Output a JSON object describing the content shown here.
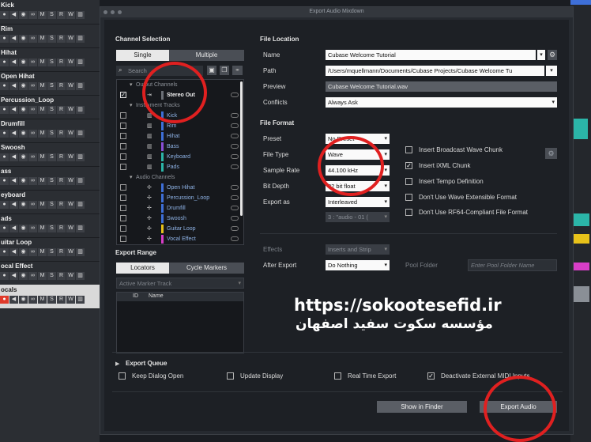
{
  "tracks": [
    {
      "name": "Kick"
    },
    {
      "name": "Rim"
    },
    {
      "name": "Hihat"
    },
    {
      "name": "Open Hihat"
    },
    {
      "name": "Percussion_Loop"
    },
    {
      "name": "Drumfill"
    },
    {
      "name": "Swoosh"
    },
    {
      "name": "ass"
    },
    {
      "name": "eyboard"
    },
    {
      "name": "ads"
    },
    {
      "name": "uitar Loop"
    },
    {
      "name": "ocal Effect"
    },
    {
      "name": "ocals"
    }
  ],
  "track_buttons": {
    "mute": "M",
    "solo": "S",
    "read": "R",
    "write": "W"
  },
  "dialog": {
    "title": "Export Audio Mixdown",
    "channel_selection": {
      "heading": "Channel Selection",
      "tab_single": "Single",
      "tab_multiple": "Multiple",
      "search_placeholder": "Search",
      "groups": {
        "output": "Output Channels",
        "instrument": "Instrument Tracks",
        "audio": "Audio Channels"
      },
      "stereo_out": "Stereo Out",
      "instrument_tracks": [
        {
          "name": "Kick",
          "color": "#3e6fd8"
        },
        {
          "name": "Rim",
          "color": "#3e6fd8"
        },
        {
          "name": "Hihat",
          "color": "#3e6fd8"
        },
        {
          "name": "Bass",
          "color": "#8a4fd8"
        },
        {
          "name": "Keyboard",
          "color": "#2bb5a8"
        },
        {
          "name": "Pads",
          "color": "#2bb5a8"
        }
      ],
      "audio_channels": [
        {
          "name": "Open Hihat",
          "color": "#3e6fd8"
        },
        {
          "name": "Percussion_Loop",
          "color": "#3e6fd8"
        },
        {
          "name": "Drumfill",
          "color": "#3e6fd8"
        },
        {
          "name": "Swoosh",
          "color": "#3e6fd8"
        },
        {
          "name": "Guitar Loop",
          "color": "#e8c21a"
        },
        {
          "name": "Vocal Effect",
          "color": "#d83ec8"
        }
      ]
    },
    "export_range": {
      "heading": "Export Range",
      "tab_locators": "Locators",
      "tab_cycle_markers": "Cycle Markers",
      "marker_track": "Active Marker Track",
      "col_id": "ID",
      "col_name": "Name"
    },
    "file_location": {
      "heading": "File Location",
      "name_label": "Name",
      "name_value": "Cubase Welcome Tutorial",
      "path_label": "Path",
      "path_value": "/Users/mquellmann/Documents/Cubase Projects/Cubase Welcome Tu",
      "preview_label": "Preview",
      "preview_value": "Cubase Welcome Tutorial.wav",
      "conflicts_label": "Conflicts",
      "conflicts_value": "Always Ask"
    },
    "file_format": {
      "heading": "File Format",
      "preset_label": "Preset",
      "preset_value": "No Preset",
      "file_type_label": "File Type",
      "file_type_value": "Wave",
      "sample_rate_label": "Sample Rate",
      "sample_rate_value": "44.100 kHz",
      "bit_depth_label": "Bit Depth",
      "bit_depth_value": "32 bit float",
      "export_as_label": "Export as",
      "export_as_value": "Interleaved",
      "naming_value": "3 : \"audio - 01 (",
      "options": [
        {
          "label": "Insert Broadcast Wave Chunk",
          "checked": false
        },
        {
          "label": "Insert iXML Chunk",
          "checked": true
        },
        {
          "label": "Insert Tempo Definition",
          "checked": false
        },
        {
          "label": "Don't Use Wave Extensible Format",
          "checked": false
        },
        {
          "label": "Don't Use RF64-Compliant File Format",
          "checked": false
        }
      ]
    },
    "effects_label": "Effects",
    "effects_value": "Inserts and Strip",
    "after_export_label": "After Export",
    "after_export_value": "Do Nothing",
    "pool_folder_label": "Pool Folder",
    "pool_folder_placeholder": "Enter Pool Folder Name",
    "export_queue": "Export Queue",
    "bottom_options": [
      {
        "label": "Keep Dialog Open",
        "checked": false
      },
      {
        "label": "Update Display",
        "checked": false
      },
      {
        "label": "Real Time Export",
        "checked": false
      },
      {
        "label": "Deactivate External MIDI Inputs",
        "checked": true
      }
    ],
    "show_in_finder": "Show in Finder",
    "export_audio": "Export Audio"
  },
  "watermark": {
    "url": "https://sokootesefid.ir",
    "org": "مؤسسه سکوت سفید اصفهان"
  },
  "colors": {
    "highlight_circle": "#e02020",
    "record": "#e03a2a",
    "channel_blue": "#8fb3e6"
  }
}
